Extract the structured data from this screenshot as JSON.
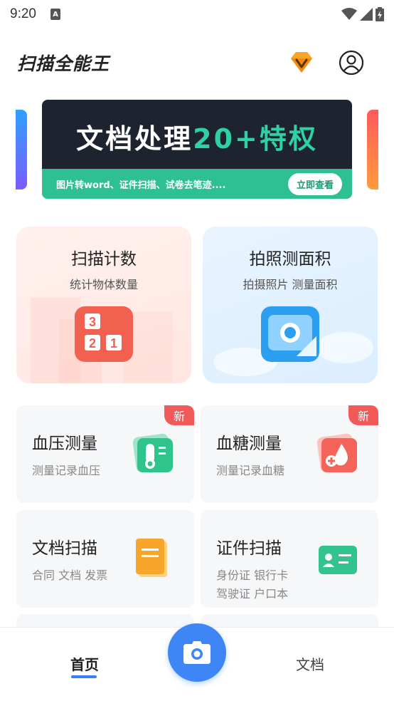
{
  "status_bar": {
    "time": "9:20",
    "notif_letter": "A"
  },
  "header": {
    "app_name": "扫描全能王",
    "vip_icon": "vip-diamond-icon",
    "profile_icon": "profile-icon"
  },
  "banner": {
    "title_part1": "文档处理",
    "title_highlight": "20+特权",
    "subtitle": "图片转word、证件扫描、试卷去笔迹....",
    "button_label": "立即查看",
    "bg_color": "#1e2330",
    "accent_color": "#2ebf93"
  },
  "feature_cards": [
    {
      "title": "扫描计数",
      "subtitle": "统计物体数量",
      "icon": "count-icon",
      "digits": [
        "3",
        "2",
        "1"
      ]
    },
    {
      "title": "拍照测面积",
      "subtitle": "拍摄照片 测量面积",
      "icon": "measure-area-icon"
    }
  ],
  "tools": [
    {
      "title": "血压测量",
      "subtitle": "测量记录血压",
      "badge": "新",
      "icon": "blood-pressure-icon"
    },
    {
      "title": "血糖测量",
      "subtitle": "测量记录血糖",
      "badge": "新",
      "icon": "blood-sugar-icon"
    },
    {
      "title": "文档扫描",
      "subtitle": "合同 文档 发票",
      "icon": "document-scan-icon"
    },
    {
      "title": "证件扫描",
      "subtitle": "身份证  银行卡",
      "subtitle2": "驾驶证  户口本",
      "icon": "id-card-scan-icon"
    }
  ],
  "bottom_nav": {
    "home_label": "首页",
    "docs_label": "文档",
    "camera_icon": "camera-icon",
    "accent_color": "#3e86f6"
  }
}
